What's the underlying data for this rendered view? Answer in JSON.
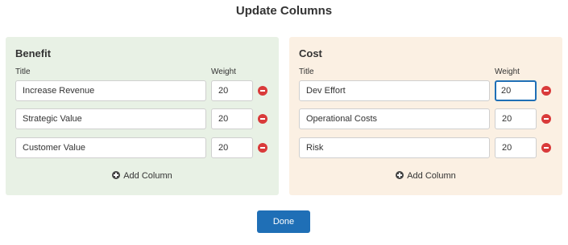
{
  "dialog": {
    "title": "Update Columns",
    "done_label": "Done"
  },
  "labels": {
    "title_header": "Title",
    "weight_header": "Weight",
    "add_column": "Add Column"
  },
  "benefit": {
    "title": "Benefit",
    "columns": [
      {
        "title": "Increase Revenue",
        "weight": "20"
      },
      {
        "title": "Strategic Value",
        "weight": "20"
      },
      {
        "title": "Customer Value",
        "weight": "20"
      }
    ]
  },
  "cost": {
    "title": "Cost",
    "columns": [
      {
        "title": "Dev Effort",
        "weight": "20"
      },
      {
        "title": "Operational Costs",
        "weight": "20"
      },
      {
        "title": "Risk",
        "weight": "20"
      }
    ]
  },
  "colors": {
    "benefit_bg": "#e8f1e5",
    "cost_bg": "#fbf0e3",
    "primary": "#1f6fb6",
    "remove": "#d93a3a"
  }
}
